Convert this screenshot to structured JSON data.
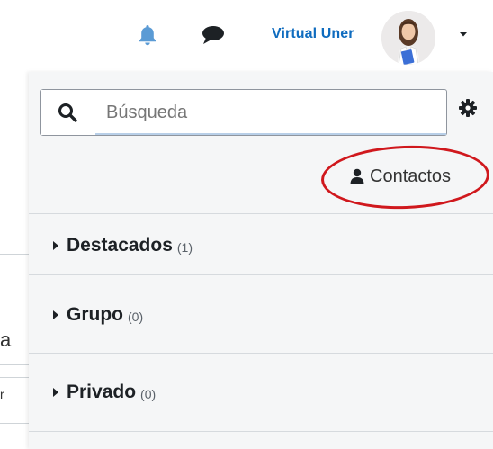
{
  "navbar": {
    "notifications_icon": "bell-icon",
    "messages_icon": "chat-icon",
    "user_name": "Virtual Uner",
    "user_menu_icon": "caret-down-icon"
  },
  "left_page": {
    "fragment_1": "a",
    "fragment_2": "r"
  },
  "drawer": {
    "search": {
      "placeholder": "Búsqueda",
      "value": ""
    },
    "settings_icon": "gear-icon",
    "contacts_label": "Contactos",
    "contacts_icon": "user-icon",
    "sections": [
      {
        "label": "Destacados",
        "count": "(1)"
      },
      {
        "label": "Grupo",
        "count": "(0)"
      },
      {
        "label": "Privado",
        "count": "(0)"
      }
    ]
  },
  "colors": {
    "accent": "#0f6cbf",
    "bell": "#5b9bd5",
    "highlight": "#d0181d",
    "drawer_bg": "#f5f6f7"
  }
}
